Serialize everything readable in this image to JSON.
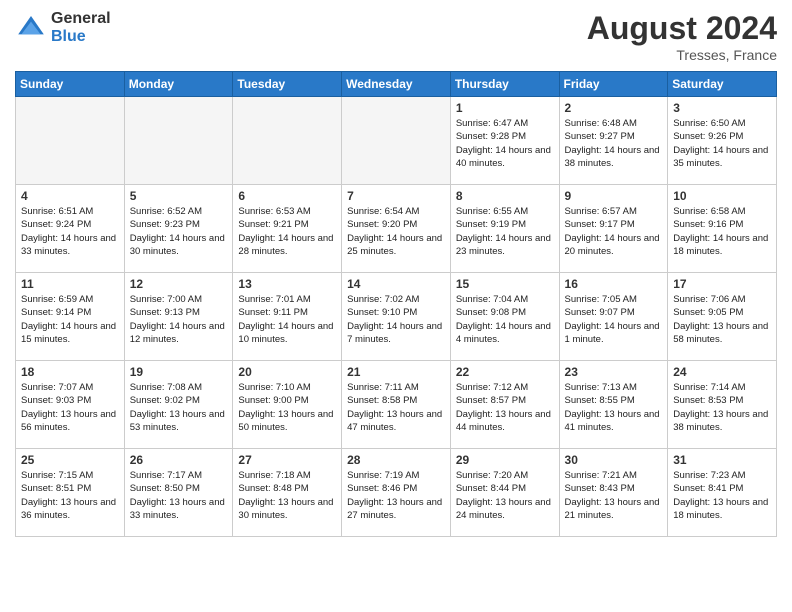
{
  "header": {
    "logo_general": "General",
    "logo_blue": "Blue",
    "month_title": "August 2024",
    "location": "Tresses, France"
  },
  "days_of_week": [
    "Sunday",
    "Monday",
    "Tuesday",
    "Wednesday",
    "Thursday",
    "Friday",
    "Saturday"
  ],
  "weeks": [
    [
      {
        "day": "",
        "empty": true
      },
      {
        "day": "",
        "empty": true
      },
      {
        "day": "",
        "empty": true
      },
      {
        "day": "",
        "empty": true
      },
      {
        "day": "1",
        "sunrise": "6:47 AM",
        "sunset": "9:28 PM",
        "daylight": "14 hours and 40 minutes."
      },
      {
        "day": "2",
        "sunrise": "6:48 AM",
        "sunset": "9:27 PM",
        "daylight": "14 hours and 38 minutes."
      },
      {
        "day": "3",
        "sunrise": "6:50 AM",
        "sunset": "9:26 PM",
        "daylight": "14 hours and 35 minutes."
      }
    ],
    [
      {
        "day": "4",
        "sunrise": "6:51 AM",
        "sunset": "9:24 PM",
        "daylight": "14 hours and 33 minutes."
      },
      {
        "day": "5",
        "sunrise": "6:52 AM",
        "sunset": "9:23 PM",
        "daylight": "14 hours and 30 minutes."
      },
      {
        "day": "6",
        "sunrise": "6:53 AM",
        "sunset": "9:21 PM",
        "daylight": "14 hours and 28 minutes."
      },
      {
        "day": "7",
        "sunrise": "6:54 AM",
        "sunset": "9:20 PM",
        "daylight": "14 hours and 25 minutes."
      },
      {
        "day": "8",
        "sunrise": "6:55 AM",
        "sunset": "9:19 PM",
        "daylight": "14 hours and 23 minutes."
      },
      {
        "day": "9",
        "sunrise": "6:57 AM",
        "sunset": "9:17 PM",
        "daylight": "14 hours and 20 minutes."
      },
      {
        "day": "10",
        "sunrise": "6:58 AM",
        "sunset": "9:16 PM",
        "daylight": "14 hours and 18 minutes."
      }
    ],
    [
      {
        "day": "11",
        "sunrise": "6:59 AM",
        "sunset": "9:14 PM",
        "daylight": "14 hours and 15 minutes."
      },
      {
        "day": "12",
        "sunrise": "7:00 AM",
        "sunset": "9:13 PM",
        "daylight": "14 hours and 12 minutes."
      },
      {
        "day": "13",
        "sunrise": "7:01 AM",
        "sunset": "9:11 PM",
        "daylight": "14 hours and 10 minutes."
      },
      {
        "day": "14",
        "sunrise": "7:02 AM",
        "sunset": "9:10 PM",
        "daylight": "14 hours and 7 minutes."
      },
      {
        "day": "15",
        "sunrise": "7:04 AM",
        "sunset": "9:08 PM",
        "daylight": "14 hours and 4 minutes."
      },
      {
        "day": "16",
        "sunrise": "7:05 AM",
        "sunset": "9:07 PM",
        "daylight": "14 hours and 1 minute."
      },
      {
        "day": "17",
        "sunrise": "7:06 AM",
        "sunset": "9:05 PM",
        "daylight": "13 hours and 58 minutes."
      }
    ],
    [
      {
        "day": "18",
        "sunrise": "7:07 AM",
        "sunset": "9:03 PM",
        "daylight": "13 hours and 56 minutes."
      },
      {
        "day": "19",
        "sunrise": "7:08 AM",
        "sunset": "9:02 PM",
        "daylight": "13 hours and 53 minutes."
      },
      {
        "day": "20",
        "sunrise": "7:10 AM",
        "sunset": "9:00 PM",
        "daylight": "13 hours and 50 minutes."
      },
      {
        "day": "21",
        "sunrise": "7:11 AM",
        "sunset": "8:58 PM",
        "daylight": "13 hours and 47 minutes."
      },
      {
        "day": "22",
        "sunrise": "7:12 AM",
        "sunset": "8:57 PM",
        "daylight": "13 hours and 44 minutes."
      },
      {
        "day": "23",
        "sunrise": "7:13 AM",
        "sunset": "8:55 PM",
        "daylight": "13 hours and 41 minutes."
      },
      {
        "day": "24",
        "sunrise": "7:14 AM",
        "sunset": "8:53 PM",
        "daylight": "13 hours and 38 minutes."
      }
    ],
    [
      {
        "day": "25",
        "sunrise": "7:15 AM",
        "sunset": "8:51 PM",
        "daylight": "13 hours and 36 minutes."
      },
      {
        "day": "26",
        "sunrise": "7:17 AM",
        "sunset": "8:50 PM",
        "daylight": "13 hours and 33 minutes."
      },
      {
        "day": "27",
        "sunrise": "7:18 AM",
        "sunset": "8:48 PM",
        "daylight": "13 hours and 30 minutes."
      },
      {
        "day": "28",
        "sunrise": "7:19 AM",
        "sunset": "8:46 PM",
        "daylight": "13 hours and 27 minutes."
      },
      {
        "day": "29",
        "sunrise": "7:20 AM",
        "sunset": "8:44 PM",
        "daylight": "13 hours and 24 minutes."
      },
      {
        "day": "30",
        "sunrise": "7:21 AM",
        "sunset": "8:43 PM",
        "daylight": "13 hours and 21 minutes."
      },
      {
        "day": "31",
        "sunrise": "7:23 AM",
        "sunset": "8:41 PM",
        "daylight": "13 hours and 18 minutes."
      }
    ]
  ]
}
